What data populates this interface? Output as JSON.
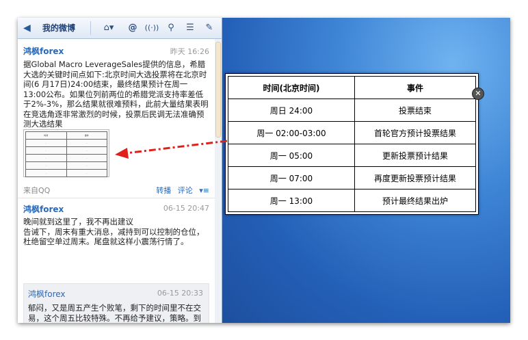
{
  "toolbar": {
    "back_icon": "back-arrow-icon",
    "title": "我的微博",
    "icons": [
      "home-icon",
      "at-icon",
      "broadcast-icon",
      "search-icon",
      "list-icon",
      "compose-icon"
    ]
  },
  "posts": [
    {
      "author": "鸿枫forex",
      "time": "昨天 16:26",
      "text": "据Global Macro LeverageSales提供的信息，希腊大选的关键时间点如下:北京时间大选投票将在北京时间(6 月17日)24:00结束，最终结果预计在周一13:00公布。如果位列前两位的希腊党派支持率差低于2%-3%，那么结果就很难预料，此前大量结果表明在竞选角逐非常激烈的时候，投票后民调无法准确预测大选结果",
      "source": "来自QQ",
      "repost": "转播",
      "comment": "评论",
      "more": "▾≡"
    },
    {
      "author": "鸿枫forex",
      "time": "06-15 20:47",
      "text": "晚间就到这里了，我不再出建议\n告诫下，周末有重大消息，减持到可以控制的仓位，杜绝留空单过周末。尾盘就这样小震荡行情了。",
      "quote": {
        "author": "鸿枫forex",
        "time": "06-15 20:33",
        "text": "郁闷，又是周五产生个败笔，剩下的时间里不在交易，这个周五比较特殊。不再给予建议，策略。到此为止此周！下周见!"
      }
    }
  ],
  "schedule": {
    "headers": [
      "时间(北京时间)",
      "事件"
    ],
    "rows": [
      [
        "周日 24:00",
        "投票结束"
      ],
      [
        "周一 02:00-03:00",
        "首轮官方预计投票结果"
      ],
      [
        "周一 05:00",
        "更新投票预计结果"
      ],
      [
        "周一 07:00",
        "再度更新投票预计结果"
      ],
      [
        "周一 13:00",
        "预计最终结果出炉"
      ]
    ]
  },
  "close_label": "✕",
  "arrow_color": "#e0201a"
}
